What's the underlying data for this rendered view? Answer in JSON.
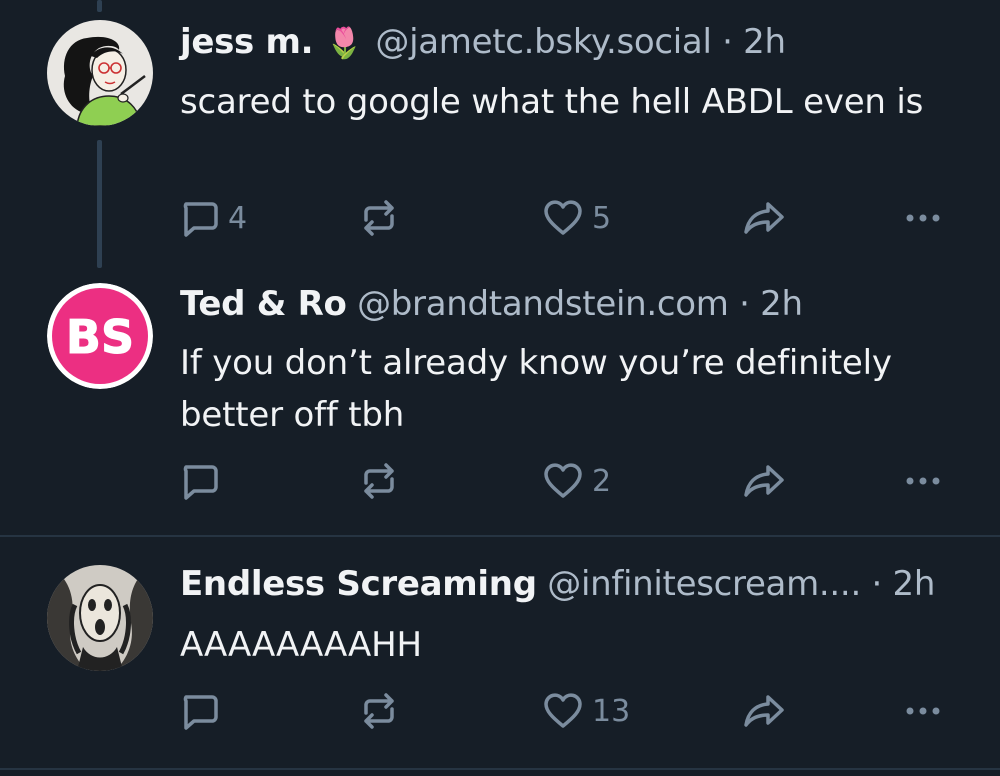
{
  "posts": [
    {
      "display_name": "jess m.",
      "emoji": "🌷",
      "handle": "@jametc.bsky.social",
      "separator": "·",
      "time": "2h",
      "text": "scared to google what the hell ABDL even is",
      "replies": "4",
      "reposts": "",
      "likes": "5",
      "avatar_icon": "illustrated-woman-avatar"
    },
    {
      "display_name": "Ted & Ro",
      "emoji": "",
      "handle": "@brandtandstein.com",
      "separator": "·",
      "time": "2h",
      "text": "If you don’t already know you’re definitely better off tbh",
      "replies": "",
      "reposts": "",
      "likes": "2",
      "avatar_text": "BS",
      "avatar_icon": "bs-logo-avatar"
    },
    {
      "display_name": "Endless Screaming",
      "emoji": "",
      "handle": "@infinitescream....",
      "separator": "·",
      "time": "2h",
      "text": "AAAAAAAAHH",
      "replies": "",
      "reposts": "",
      "likes": "13",
      "avatar_icon": "the-scream-avatar"
    }
  ],
  "colors": {
    "background": "#161e27",
    "text": "#f1f3f5",
    "muted": "#aebbc9",
    "icon": "#7b8c9e",
    "thread_line": "#2e4052",
    "bs_pink": "#ec2f82"
  }
}
